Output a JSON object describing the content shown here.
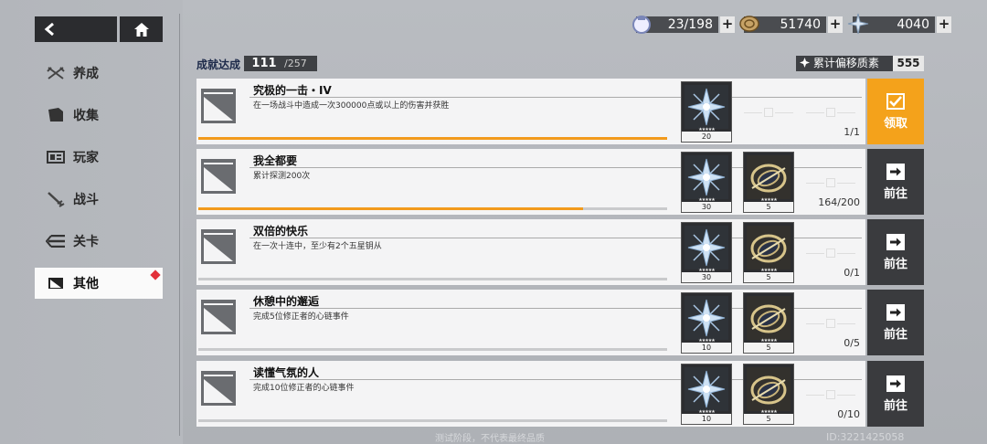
{
  "top": {
    "back_icon": "back-arrow-icon",
    "home_icon": "home-icon"
  },
  "nav": {
    "items": [
      {
        "label": "养成",
        "icon": "cross-swords-icon"
      },
      {
        "label": "收集",
        "icon": "folder-icon"
      },
      {
        "label": "玩家",
        "icon": "profile-card-icon"
      },
      {
        "label": "战斗",
        "icon": "sword-icon"
      },
      {
        "label": "关卡",
        "icon": "stage-icon"
      },
      {
        "label": "其他",
        "icon": "other-flag-icon",
        "active": true,
        "badge": "red-dot"
      }
    ]
  },
  "resources": [
    {
      "name": "stamina",
      "icon": "stamina-icon",
      "value": "23/198"
    },
    {
      "name": "coin",
      "icon": "coin-icon",
      "value": "51740"
    },
    {
      "name": "crystal",
      "icon": "crystal-icon",
      "value": "4040"
    }
  ],
  "summary": {
    "achieved_label": "成就达成",
    "achieved_count": "111",
    "achieved_total": "/257",
    "offset_label": "累计偏移质素",
    "offset_value": "555"
  },
  "achievements": [
    {
      "title": "究极的一击・IV",
      "desc": "在一场战斗中造成一次300000点或以上的伤害并获胜",
      "progress_text": "1/1",
      "progress": 1.0,
      "rewards": [
        {
          "type": "crystal",
          "count": "20"
        }
      ],
      "action": "领取",
      "action_type": "claim"
    },
    {
      "title": "我全都要",
      "desc": "累计探测200次",
      "progress_text": "164/200",
      "progress": 0.82,
      "rewards": [
        {
          "type": "crystal",
          "count": "30"
        },
        {
          "type": "ring",
          "count": "5"
        }
      ],
      "action": "前往",
      "action_type": "go"
    },
    {
      "title": "双倍的快乐",
      "desc": "在一次十连中，至少有2个五星钥从",
      "progress_text": "0/1",
      "progress": 0,
      "rewards": [
        {
          "type": "crystal",
          "count": "30"
        },
        {
          "type": "ring",
          "count": "5"
        }
      ],
      "action": "前往",
      "action_type": "go"
    },
    {
      "title": "休憩中的邂逅",
      "desc": "完成5位修正者的心链事件",
      "progress_text": "0/5",
      "progress": 0,
      "rewards": [
        {
          "type": "crystal",
          "count": "10"
        },
        {
          "type": "ring",
          "count": "5"
        }
      ],
      "action": "前往",
      "action_type": "go"
    },
    {
      "title": "读懂气氛的人",
      "desc": "完成10位修正者的心链事件",
      "progress_text": "0/10",
      "progress": 0,
      "rewards": [
        {
          "type": "crystal",
          "count": "10"
        },
        {
          "type": "ring",
          "count": "5"
        }
      ],
      "action": "前往",
      "action_type": "go"
    }
  ],
  "footer": {
    "notice": "测试阶段，不代表最终品质",
    "uid": "ID:3221425058"
  }
}
